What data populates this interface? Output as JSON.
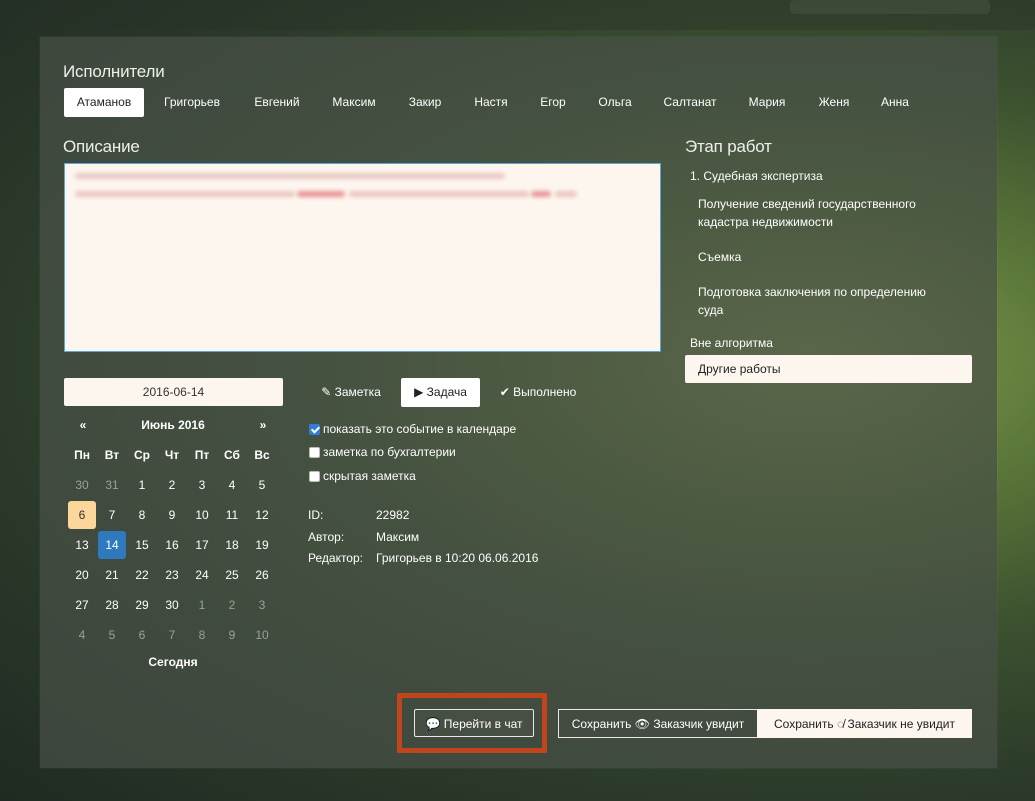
{
  "performers": {
    "title": "Исполнители",
    "tabs": [
      "Атаманов",
      "Григорьев",
      "Евгений",
      "Максим",
      "Закир",
      "Настя",
      "Егор",
      "Ольга",
      "Салтанат",
      "Мария",
      "Женя",
      "Анна"
    ],
    "active_index": 0
  },
  "description": {
    "title": "Описание"
  },
  "stages": {
    "title": "Этап работ",
    "group1": "1. Судебная экспертиза",
    "items": [
      "Получение сведений государственного кадастра недвижимости",
      "Съемка",
      "Подготовка заключения по определению суда"
    ],
    "outside_title": "Вне алгоритма",
    "outside_selected": "Другие работы"
  },
  "date": {
    "value": "2016-06-14"
  },
  "calendar": {
    "prev": "«",
    "next": "»",
    "month_label": "Июнь 2016",
    "weekdays": [
      "Пн",
      "Вт",
      "Ср",
      "Чт",
      "Пт",
      "Сб",
      "Вс"
    ],
    "weeks": [
      [
        "30",
        "31",
        "1",
        "2",
        "3",
        "4",
        "5"
      ],
      [
        "6",
        "7",
        "8",
        "9",
        "10",
        "11",
        "12"
      ],
      [
        "13",
        "14",
        "15",
        "16",
        "17",
        "18",
        "19"
      ],
      [
        "20",
        "21",
        "22",
        "23",
        "24",
        "25",
        "26"
      ],
      [
        "27",
        "28",
        "29",
        "30",
        "1",
        "2",
        "3"
      ],
      [
        "4",
        "5",
        "6",
        "7",
        "8",
        "9",
        "10"
      ]
    ],
    "today_label": "Сегодня"
  },
  "type_buttons": {
    "note": "Заметка",
    "task": "Задача",
    "done": "Выполнено",
    "active": "task"
  },
  "checkboxes": [
    {
      "label": "показать это событие в календаре",
      "checked": true
    },
    {
      "label": "заметка по бухгалтерии",
      "checked": false
    },
    {
      "label": "скрытая заметка",
      "checked": false
    }
  ],
  "info": {
    "id_label": "ID:",
    "id_value": "22982",
    "author_label": "Автор:",
    "author_value": "Максим",
    "editor_label": "Редактор:",
    "editor_value": "Григорьев в 10:20 06.06.2016"
  },
  "actions": {
    "chat": "Перейти в чат",
    "save_visible": "Сохранить",
    "save_visible_suffix": "Заказчик увидит",
    "save_hidden": "Сохранить",
    "save_hidden_suffix": "Заказчик не увидит"
  }
}
